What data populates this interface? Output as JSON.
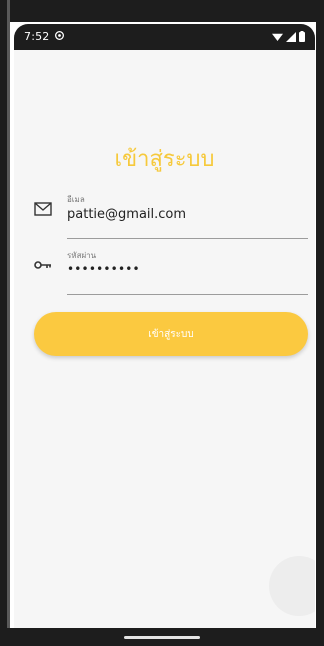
{
  "status_bar": {
    "time": "7:52",
    "icons": [
      "settings-icon",
      "wifi-icon",
      "signal-icon",
      "battery-icon"
    ]
  },
  "login": {
    "title": "เข้าสู่ระบบ",
    "email": {
      "label": "อีเมล",
      "value": "pattie@gmail.com",
      "icon": "mail-icon"
    },
    "password": {
      "label": "รหัสผ่าน",
      "value": "••••••••••",
      "icon": "key-icon"
    },
    "button_label": "เข้าสู่ระบบ"
  },
  "colors": {
    "accent": "#fbc940",
    "title": "#f6c93b",
    "background": "#f6f6f6",
    "bezel": "#1d1d1d"
  }
}
